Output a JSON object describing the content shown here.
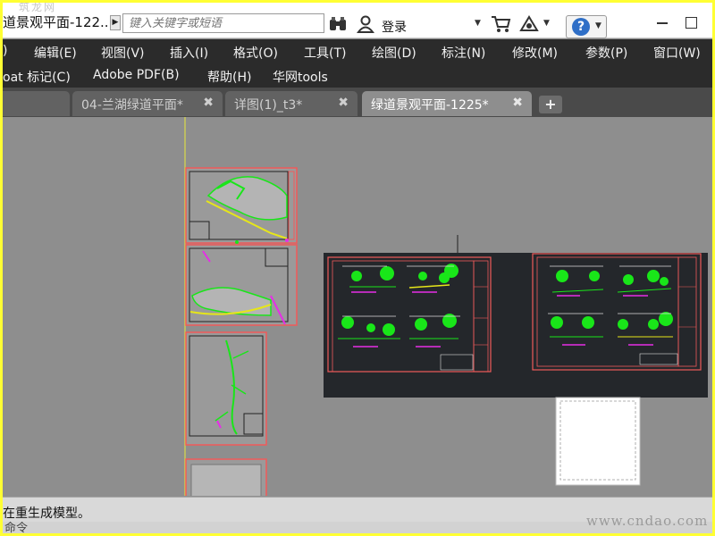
{
  "titlebar": {
    "doc_title": "道景观平面-122...",
    "search_placeholder": "键入关键字或短语",
    "login_label": "登录",
    "watermark": "筑龙网"
  },
  "menu": {
    "row1": [
      ")",
      "编辑(E)",
      "视图(V)",
      "插入(I)",
      "格式(O)",
      "工具(T)",
      "绘图(D)",
      "标注(N)",
      "修改(M)",
      "参数(P)",
      "窗口(W)"
    ],
    "row2": [
      "oat 标记(C)",
      "Adobe PDF(B)",
      "帮助(H)",
      "华网tools"
    ]
  },
  "tabs": [
    {
      "label": "04-兰湖绿道平面*",
      "active": false
    },
    {
      "label": "详图(1)_t3*",
      "active": false
    },
    {
      "label": "绿道景观平面-1225*",
      "active": true
    }
  ],
  "status": {
    "message": "在重生成模型。",
    "command_label": "命令"
  },
  "watermark_url": "www.cndao.com",
  "colors": {
    "page_border": "#ffff33",
    "menu_bg": "#2b2b2b",
    "canvas_bg": "#8e8e8e",
    "cad_sheet_bg": "#24272b",
    "frame_red": "#f05a5a",
    "plant_green": "#19e619",
    "magenta": "#e62ee6"
  },
  "icons": [
    "expand-icon",
    "binoculars-icon",
    "user-icon",
    "cart-icon",
    "exchange-icon",
    "help-icon",
    "minimize-icon",
    "restore-icon",
    "close-icon",
    "plus-icon"
  ]
}
